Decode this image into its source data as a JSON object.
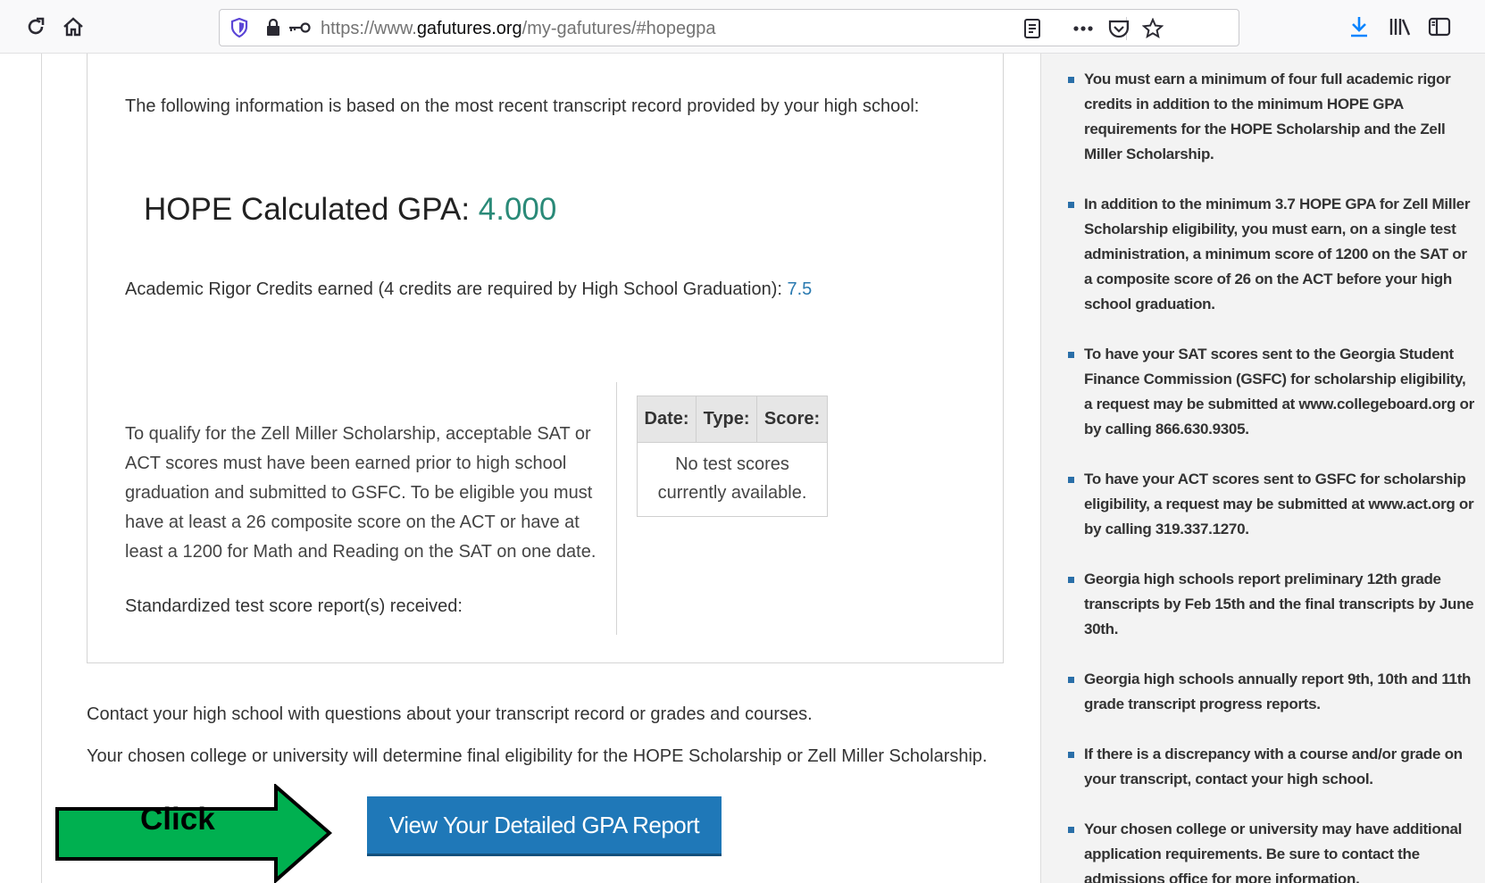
{
  "browser": {
    "url_prefix": "https://www.",
    "url_host": "gafutures.org",
    "url_path": "/my-gafutures/#hopegpa",
    "icons": [
      "reload-icon",
      "home-icon",
      "shield-icon",
      "lock-icon",
      "key-icon",
      "reader-view-icon",
      "more-icon",
      "pocket-icon",
      "bookmark-star-icon",
      "download-icon",
      "library-icon",
      "sidebar-icon"
    ],
    "accent_color": "#0a84ff"
  },
  "main": {
    "intro": "The following information is based on the most recent transcript record provided by your high school:",
    "gpa_label": "HOPE Calculated GPA: ",
    "gpa_value": "4.000",
    "rigor_label": "Academic Rigor Credits earned (4 credits are required by High School Graduation): ",
    "rigor_value": "7.5",
    "zell_text": "To qualify for the Zell Miller Scholarship, acceptable SAT or ACT scores must have been earned prior to high school graduation and submitted to GSFC. To be eligible you must have at least a 26 composite score on the ACT or have at least a 1200 for Math and Reading on the SAT on one date.",
    "std_reports": "Standardized test score report(s) received:",
    "score_table": {
      "headers": [
        "Date:",
        "Type:",
        "Score:"
      ],
      "empty_message": "No test scores currently available."
    },
    "contact_text": "Contact your high school with questions about your transcript record or grades and courses.",
    "college_text": "Your chosen college or university will determine final eligibility for the HOPE Scholarship or Zell Miller Scholarship.",
    "gpa_button_label": "View Your Detailed GPA Report",
    "arrow_label": "Click",
    "colors": {
      "gpa_value": "#2a8a78",
      "rigor_value": "#2a7ab0",
      "button": "#1f78b8",
      "arrow": "#00b050"
    }
  },
  "sidebar": {
    "items": [
      "You must earn a minimum of four full academic rigor credits in addition to the minimum HOPE GPA requirements for the HOPE Scholarship and the Zell Miller Scholarship.",
      "In addition to the minimum 3.7 HOPE GPA for Zell Miller Scholarship eligibility, you must earn, on a single test administration, a minimum score of 1200 on the SAT or a composite score of 26 on the ACT before your high school graduation.",
      "To have your SAT scores sent to the Georgia Student Finance Commission (GSFC) for scholarship eligibility, a request may be submitted at www.collegeboard.org or by calling 866.630.9305.",
      "To have your ACT scores sent to GSFC for scholarship eligibility, a request may be submitted at www.act.org or by calling 319.337.1270.",
      "Georgia high schools report preliminary 12th grade transcripts by Feb 15th and the final transcripts by June 30th.",
      "Georgia high schools annually report 9th, 10th and 11th grade transcript progress reports.",
      "If there is a discrepancy with a course and/or grade on your transcript, contact your high school.",
      "Your chosen college or university may have additional application requirements. Be sure to contact the admissions office for more information."
    ]
  }
}
